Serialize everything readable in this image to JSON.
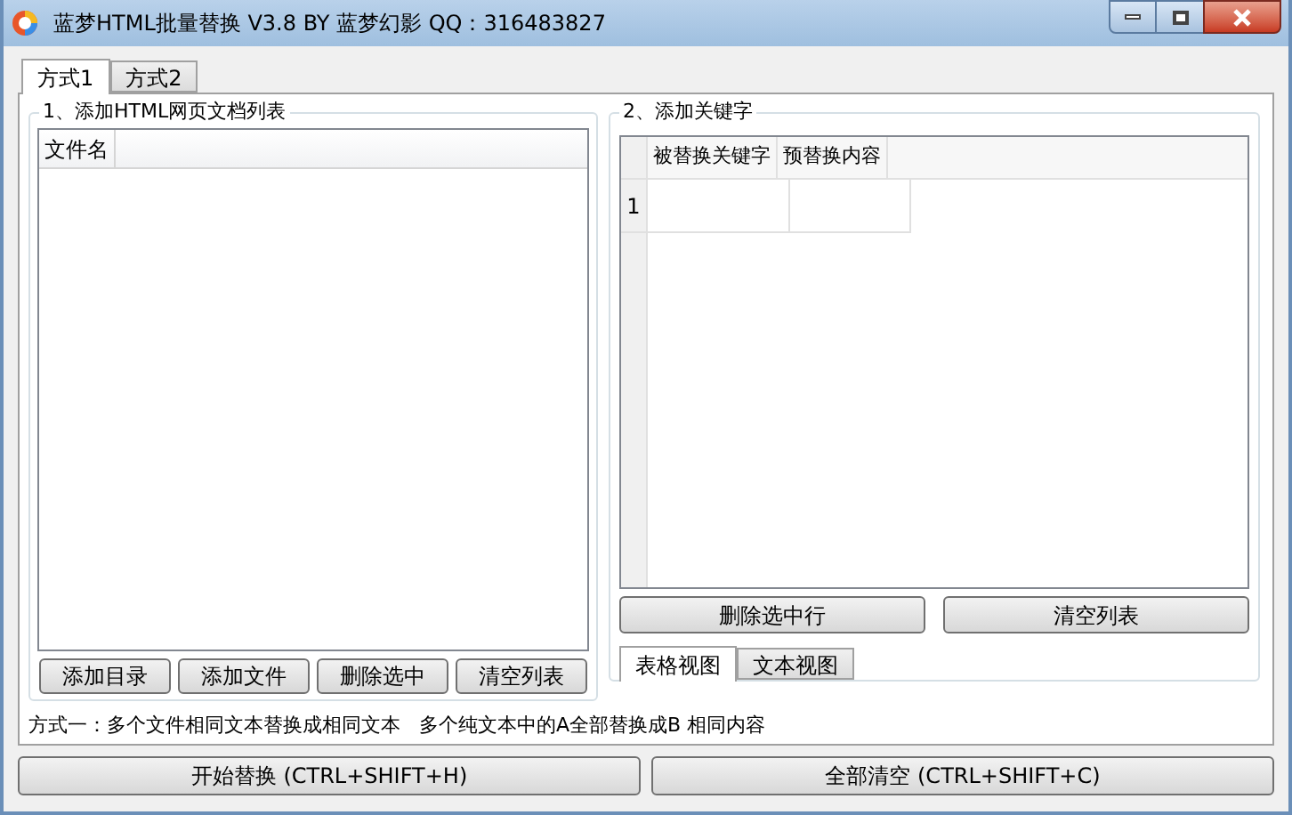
{
  "window": {
    "title": "蓝梦HTML批量替换 V3.8 BY 蓝梦幻影 QQ：316483827"
  },
  "tabs": [
    {
      "label": "方式1",
      "selected": true
    },
    {
      "label": "方式2",
      "selected": false
    }
  ],
  "file_list": {
    "title": "1、添加HTML网页文档列表",
    "columns": [
      "文件名"
    ],
    "buttons": [
      "添加目录",
      "添加文件",
      "删除选中",
      "清空列表"
    ]
  },
  "keywords": {
    "title": "2、添加关键字",
    "columns": [
      "被替换关键字",
      "预替换内容"
    ],
    "rows": [
      {
        "number": "1"
      }
    ],
    "buttons": [
      "删除选中行",
      "清空列表"
    ],
    "view_tabs": [
      {
        "label": "表格视图",
        "selected": true
      },
      {
        "label": "文本视图",
        "selected": false
      }
    ]
  },
  "note": "方式一：多个文件相同文本替换成相同文本   多个纯文本中的A全部替换成B 相同内容",
  "bottom_buttons": [
    "开始替换 (CTRL+SHIFT+H)",
    "全部清空 (CTRL+SHIFT+C)"
  ]
}
